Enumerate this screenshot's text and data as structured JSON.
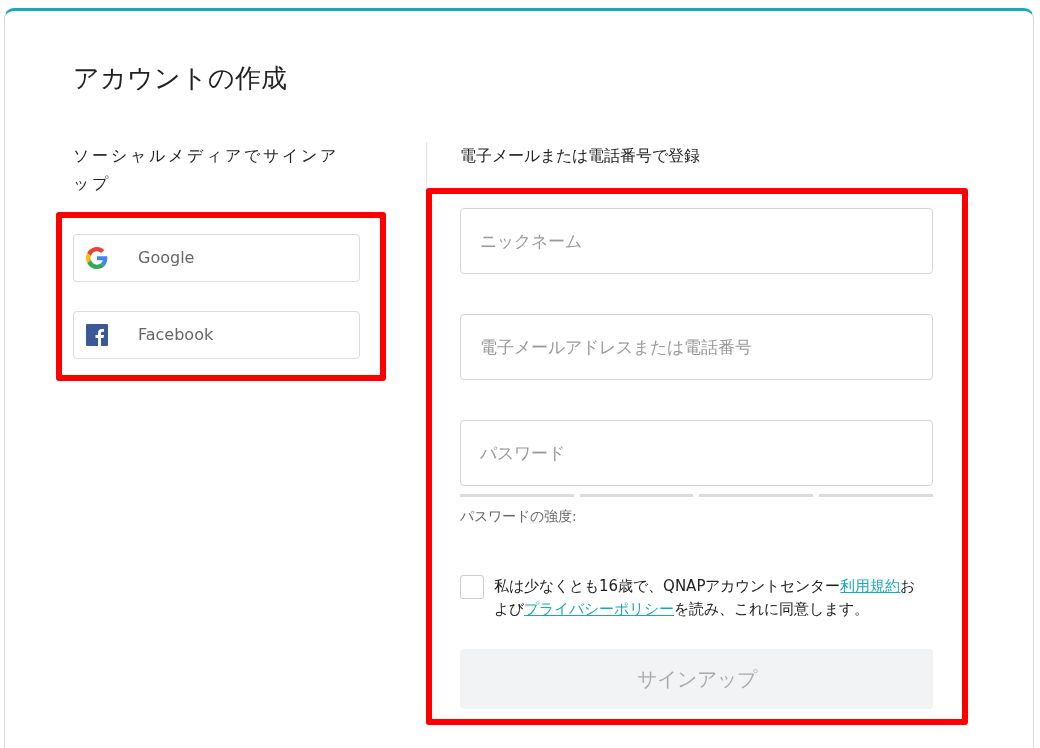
{
  "title": "アカウントの作成",
  "social": {
    "heading": "ソーシャルメディアでサインアップ",
    "buttons": [
      {
        "kind": "google",
        "label": "Google"
      },
      {
        "kind": "facebook",
        "label": "Facebook"
      }
    ]
  },
  "register": {
    "heading": "電子メールまたは電話番号で登録",
    "fields": [
      {
        "placeholder": "ニックネーム"
      },
      {
        "placeholder": "電子メールアドレスまたは電話番号"
      },
      {
        "placeholder": "パスワード"
      }
    ],
    "strength": {
      "label": "パスワードの強度:"
    },
    "agreement": {
      "checked": false,
      "parts": [
        {
          "kind": "text",
          "text": "私は少なくとも16歳で、QNAPアカウントセンター"
        },
        {
          "kind": "link",
          "text": "利用規約"
        },
        {
          "kind": "text",
          "text": "および"
        },
        {
          "kind": "link",
          "text": "プライバシーポリシー"
        },
        {
          "kind": "text",
          "text": "を読み、これに同意します。"
        }
      ]
    },
    "submit": {
      "label": "サインアップ",
      "disabled": true
    }
  }
}
